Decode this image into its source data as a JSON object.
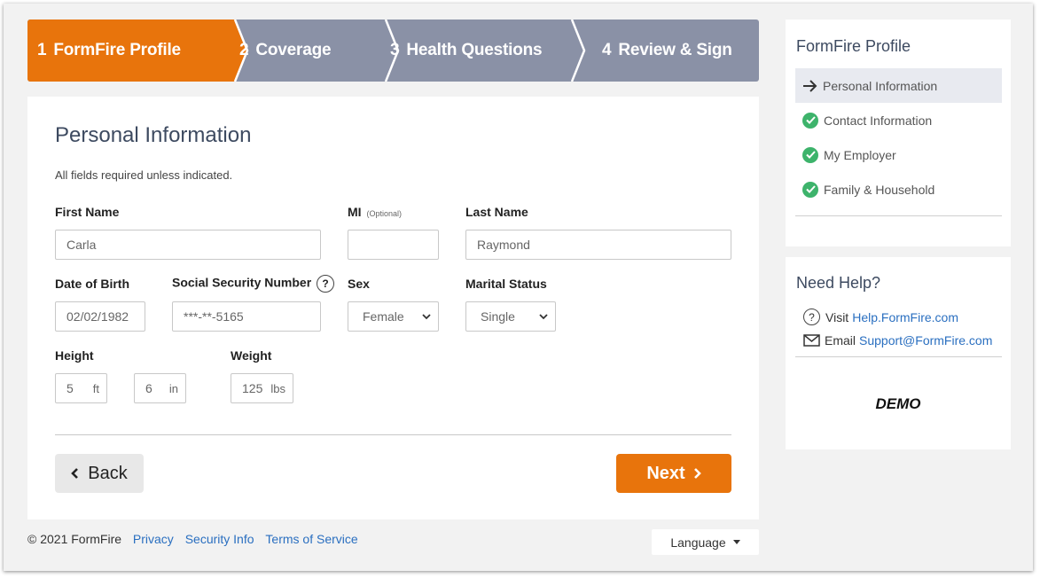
{
  "steps": [
    {
      "num": "1",
      "label": "FormFire Profile",
      "active": true
    },
    {
      "num": "2",
      "label": "Coverage",
      "active": false
    },
    {
      "num": "3",
      "label": "Health Questions",
      "active": false
    },
    {
      "num": "4",
      "label": "Review & Sign",
      "active": false
    }
  ],
  "form": {
    "title": "Personal Information",
    "note": "All fields required unless indicated.",
    "first_name": {
      "label": "First Name",
      "value": "Carla"
    },
    "mi": {
      "label": "MI",
      "optional": "(Optional)",
      "value": ""
    },
    "last_name": {
      "label": "Last Name",
      "value": "Raymond"
    },
    "dob": {
      "label": "Date of Birth",
      "value": "02/02/1982"
    },
    "ssn": {
      "label": "Social Security Number",
      "value": "***-**-5165"
    },
    "sex": {
      "label": "Sex",
      "value": "Female"
    },
    "marital": {
      "label": "Marital Status",
      "value": "Single"
    },
    "height": {
      "label": "Height",
      "feet": "5",
      "feet_unit": "ft",
      "inches": "6",
      "inches_unit": "in"
    },
    "weight": {
      "label": "Weight",
      "value": "125",
      "unit": "lbs"
    },
    "back_label": "Back",
    "next_label": "Next"
  },
  "footer": {
    "copyright": "© 2021 FormFire",
    "links": [
      "Privacy",
      "Security Info",
      "Terms of Service"
    ],
    "language": "Language"
  },
  "sidebar": {
    "title": "FormFire Profile",
    "items": [
      {
        "label": "Personal Information",
        "icon": "arrow-right-icon",
        "active": true
      },
      {
        "label": "Contact Information",
        "icon": "check-circle-icon",
        "active": false
      },
      {
        "label": "My Employer",
        "icon": "check-circle-icon",
        "active": false
      },
      {
        "label": "Family & Household",
        "icon": "check-circle-icon",
        "active": false
      }
    ]
  },
  "help": {
    "title": "Need Help?",
    "visit_prefix": "Visit",
    "visit_link": "Help.FormFire.com",
    "email_prefix": "Email",
    "email_link": "Support@FormFire.com",
    "demo": "DEMO"
  },
  "colors": {
    "accent": "#e8740c",
    "stepper": "#8a91a6",
    "link": "#2a6fc0",
    "check": "#3db36b"
  }
}
